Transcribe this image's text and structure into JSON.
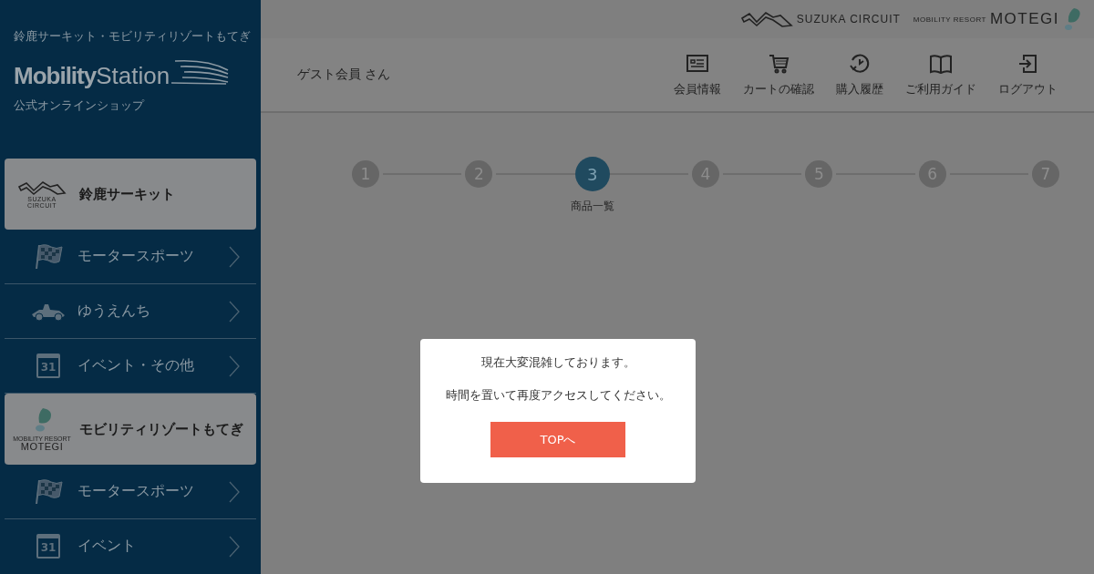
{
  "brand": {
    "tagline": "鈴鹿サーキット・モビリティリゾートもてぎ",
    "logo_bold": "Mobility",
    "logo_light": "Station",
    "subtitle": "公式オンラインショップ"
  },
  "sidebar": {
    "sections": [
      {
        "kind": "suzuka",
        "title": "鈴鹿サーキット",
        "logo_lines": [
          "SUZUKA",
          "CIRCUIT"
        ],
        "items": [
          {
            "kind": "flag",
            "label": "モータースポーツ"
          },
          {
            "kind": "kart",
            "label": "ゆうえんち"
          },
          {
            "kind": "calendar",
            "icon_text": "31",
            "label": "イベント・その他"
          }
        ]
      },
      {
        "kind": "motegi",
        "title": "モビリティリゾートもてぎ",
        "logo_lines": [
          "MOBILITY RESORT",
          "MOTEGI"
        ],
        "items": [
          {
            "kind": "flag",
            "label": "モータースポーツ"
          },
          {
            "kind": "calendar",
            "icon_text": "31",
            "label": "イベント"
          }
        ]
      }
    ]
  },
  "top_logos": {
    "suzuka": "SUZUKA CIRCUIT",
    "motegi_small": "MOBILITY RESORT",
    "motegi": "MOTEGI"
  },
  "header": {
    "user": "ゲスト会員 さん",
    "nav": [
      {
        "label": "会員情報"
      },
      {
        "label": "カートの確認"
      },
      {
        "label": "購入履歴"
      },
      {
        "label": "ご利用ガイド"
      },
      {
        "label": "ログアウト"
      }
    ]
  },
  "steps": [
    {
      "number": "1",
      "selected": false
    },
    {
      "number": "2",
      "selected": false
    },
    {
      "number": "3",
      "selected": true,
      "label": "商品一覧"
    },
    {
      "number": "4",
      "selected": false
    },
    {
      "number": "5",
      "selected": false
    },
    {
      "number": "6",
      "selected": false
    },
    {
      "number": "7",
      "selected": false
    }
  ],
  "dialog": {
    "messages": [
      "現在大変混雑しております。",
      "時間を置いて再度アクセスしてください。"
    ],
    "button": "TOPへ"
  }
}
